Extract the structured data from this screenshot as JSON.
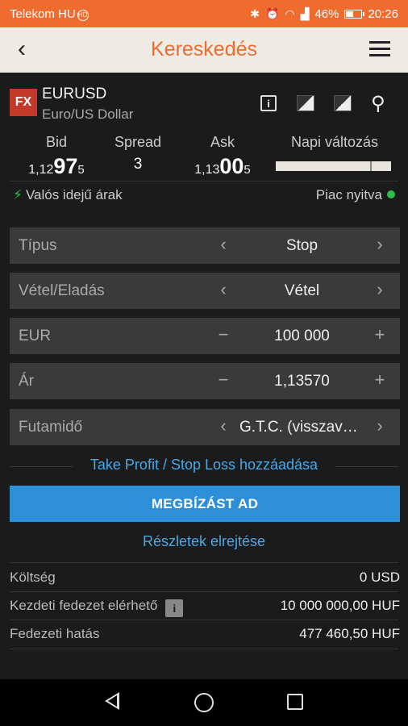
{
  "status": {
    "carrier": "Telekom HU",
    "battery": "46%",
    "time": "20:26"
  },
  "appbar": {
    "title": "Kereskedés"
  },
  "instrument": {
    "badge": "FX",
    "symbol": "EURUSD",
    "name": "Euro/US Dollar"
  },
  "quote": {
    "bid_label": "Bid",
    "bid_prefix": "1,12",
    "bid_big": "97",
    "bid_pip": "5",
    "spread_label": "Spread",
    "spread_value": "3",
    "ask_label": "Ask",
    "ask_prefix": "1,13",
    "ask_big": "00",
    "ask_pip": "5",
    "daily_label": "Napi változás"
  },
  "info": {
    "realtime": "Valós idejű árak",
    "market": "Piac nyitva"
  },
  "form": {
    "rows": [
      {
        "label": "Típus",
        "value": "Stop"
      },
      {
        "label": "Vétel/Eladás",
        "value": "Vétel"
      },
      {
        "label": "EUR",
        "value": "100 000"
      },
      {
        "label": "Ár",
        "value": "1,13570"
      },
      {
        "label": "Futamidő",
        "value": "G.T.C. (visszavonásig)"
      }
    ]
  },
  "actions": {
    "tpsl": "Take Profit / Stop Loss hozzáadása",
    "place": "MEGBÍZÁST AD",
    "hide": "Részletek elrejtése"
  },
  "details": [
    {
      "label": "Költség",
      "value": "0 USD"
    },
    {
      "label": "Kezdeti fedezet elérhető",
      "value": "10 000 000,00 HUF"
    },
    {
      "label": "Fedezeti hatás",
      "value": "477 460,50 HUF"
    }
  ]
}
